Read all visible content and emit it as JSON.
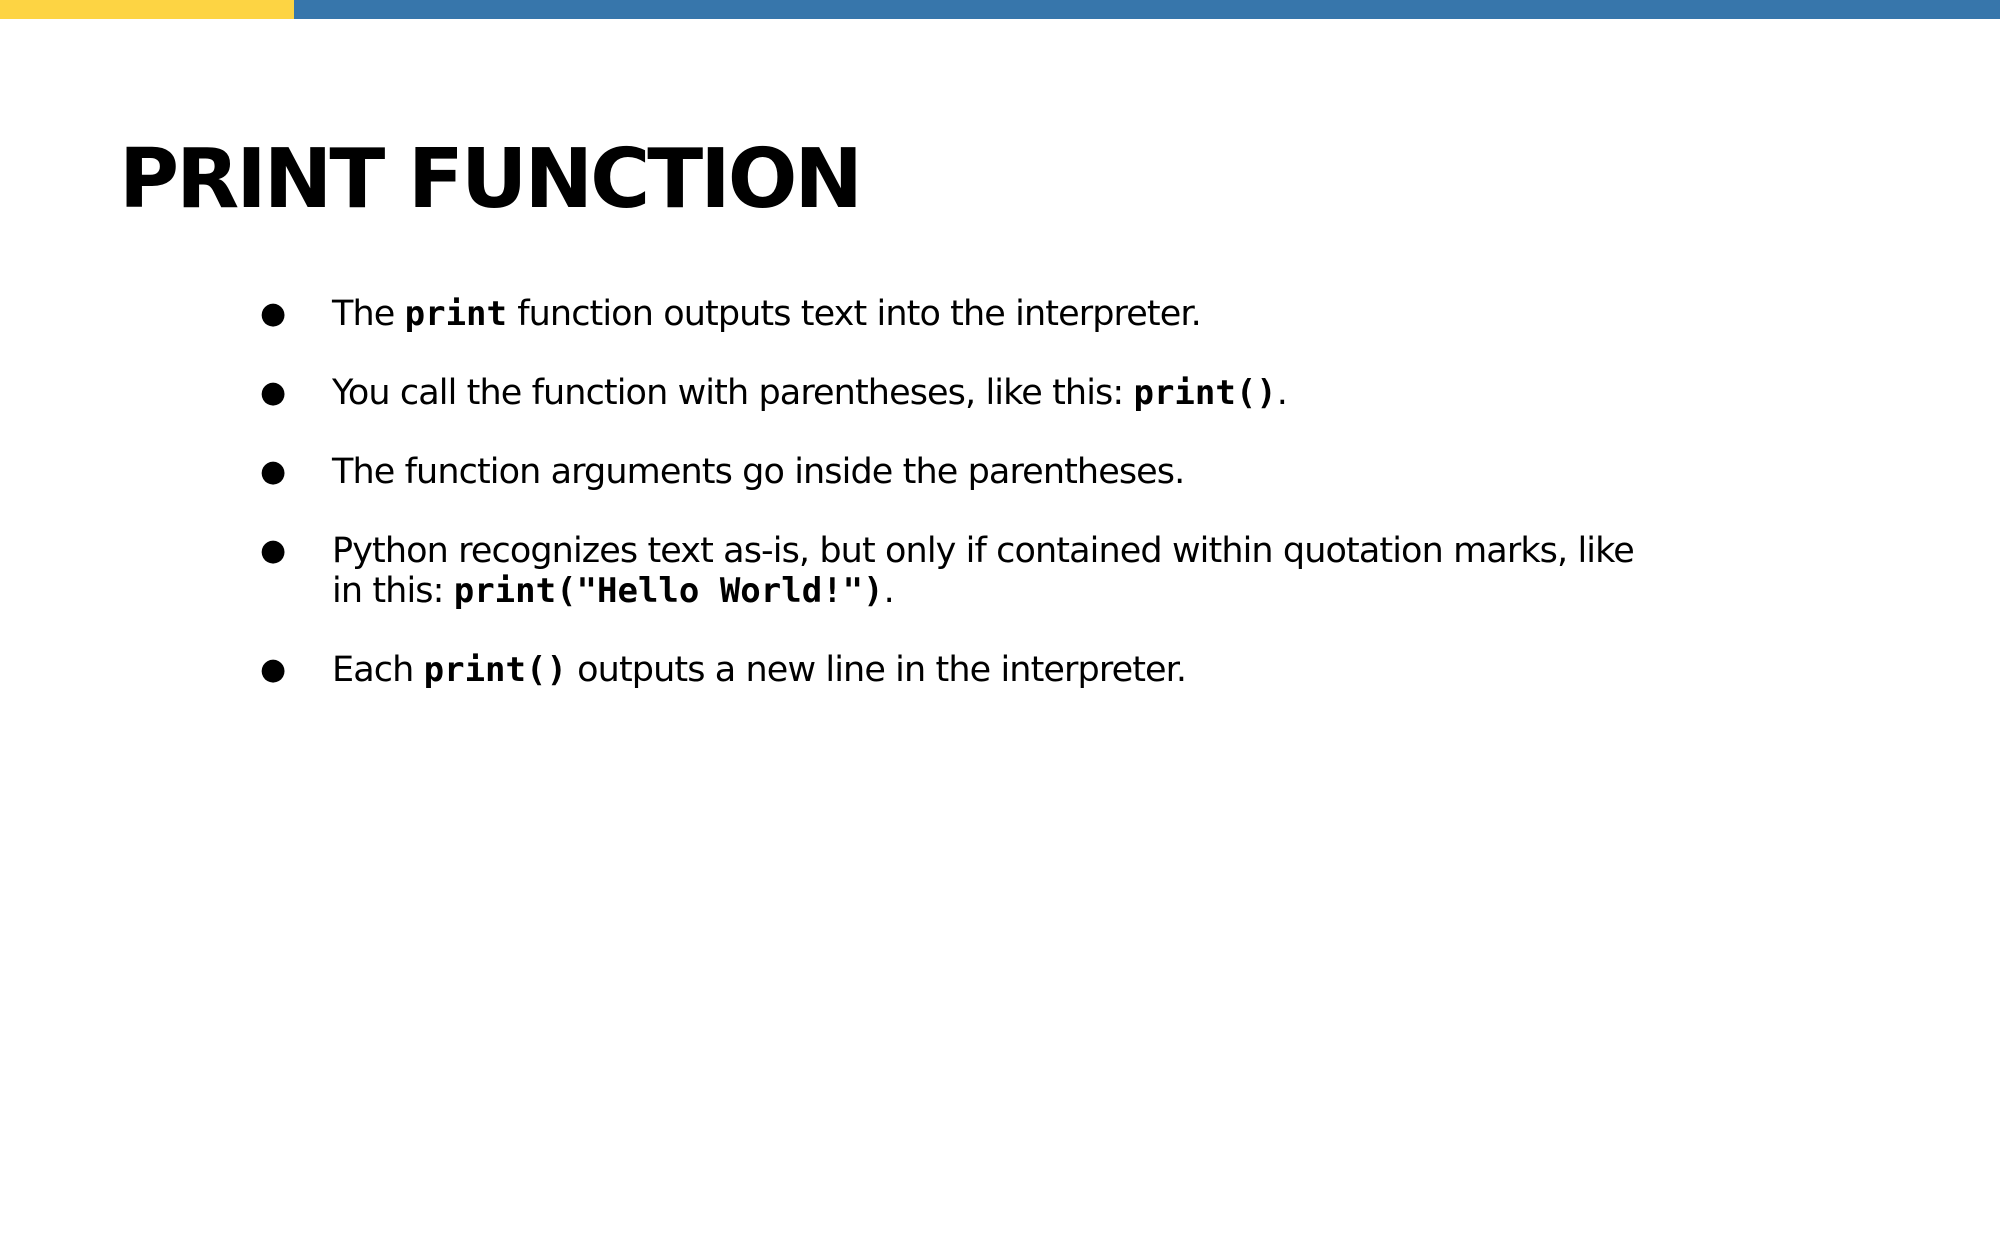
{
  "colors": {
    "accent_yellow": "#FDD443",
    "accent_blue": "#3776AB"
  },
  "slide": {
    "title": "PRINT FUNCTION",
    "bullets": [
      {
        "parts": [
          {
            "text": "The ",
            "code": false
          },
          {
            "text": "print",
            "code": true
          },
          {
            "text": " function outputs text into the interpreter.",
            "code": false
          }
        ]
      },
      {
        "parts": [
          {
            "text": "You call the function with parentheses, like this: ",
            "code": false
          },
          {
            "text": "print()",
            "code": true
          },
          {
            "text": ".",
            "code": false
          }
        ]
      },
      {
        "parts": [
          {
            "text": "The function arguments go inside the parentheses.",
            "code": false
          }
        ]
      },
      {
        "parts": [
          {
            "text": "Python recognizes text as-is, but only if contained within quotation marks, like in this: ",
            "code": false
          },
          {
            "text": "print(\"Hello World!\")",
            "code": true
          },
          {
            "text": ".",
            "code": false
          }
        ]
      },
      {
        "parts": [
          {
            "text": "Each ",
            "code": false
          },
          {
            "text": "print()",
            "code": true
          },
          {
            "text": " outputs a new line in the interpreter.",
            "code": false
          }
        ]
      }
    ]
  }
}
